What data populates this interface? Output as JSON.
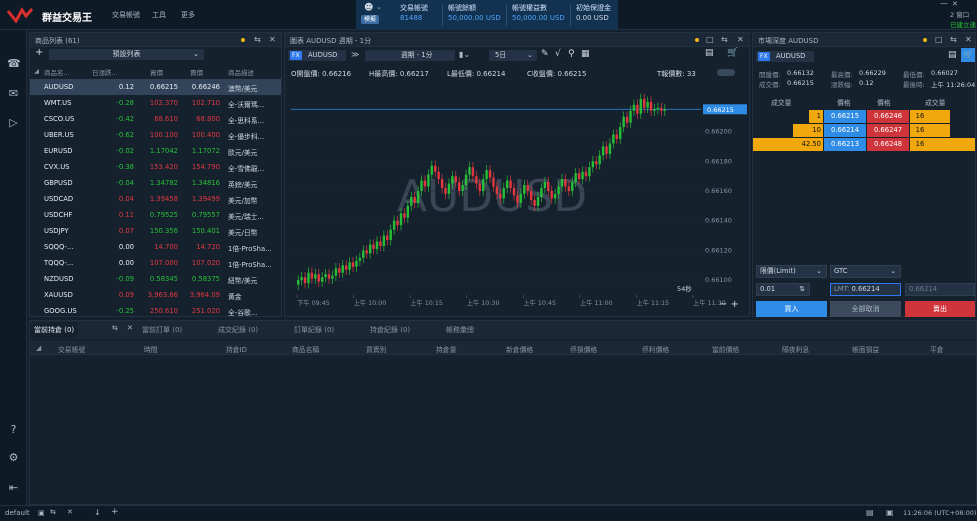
{
  "app": {
    "brand": "群益交易王",
    "menu": [
      "交易帳號",
      "工具",
      "更多"
    ]
  },
  "account": {
    "trade_label": "交易帳號",
    "trade_value": "81488",
    "badge": "模擬",
    "fields": [
      {
        "label": "帳號餘額",
        "value": "50,000.00 USD"
      },
      {
        "label": "帳號權益數",
        "value": "50,000.00 USD"
      },
      {
        "label": "初始保證金",
        "value": "0.00 USD"
      }
    ]
  },
  "window": {
    "zoom_label": "2 窗口",
    "status": "已建立連"
  },
  "product_list": {
    "title": "商品列表 (61)",
    "preset": "預設列表",
    "headers": [
      "商品名...",
      "日漲跌...",
      "買價",
      "賣價",
      "商品描述"
    ],
    "rows": [
      {
        "symbol": "AUDUSD",
        "change": "0.12",
        "bid": "0.66215",
        "ask": "0.66246",
        "desc": "澳幣/美元",
        "dir": "fl",
        "bdir": "fl",
        "selected": true
      },
      {
        "symbol": "WMT.US",
        "change": "-0.28",
        "bid": "102.370",
        "ask": "102.710",
        "desc": "全-沃爾瑪...",
        "dir": "up",
        "bdir": "dn"
      },
      {
        "symbol": "CSCO.US",
        "change": "-0.42",
        "bid": "68.610",
        "ask": "68.800",
        "desc": "全-思科系...",
        "dir": "up",
        "bdir": "dn"
      },
      {
        "symbol": "UBER.US",
        "change": "-0.62",
        "bid": "100.100",
        "ask": "100.400",
        "desc": "全-優步科...",
        "dir": "up",
        "bdir": "dn"
      },
      {
        "symbol": "EURUSD",
        "change": "-0.02",
        "bid": "1.17042",
        "ask": "1.17072",
        "desc": "歐元/美元",
        "dir": "up",
        "bdir": "up"
      },
      {
        "symbol": "CVX.US",
        "change": "-0.38",
        "bid": "153.420",
        "ask": "154.790",
        "desc": "全-雪佛龍...",
        "dir": "up",
        "bdir": "dn"
      },
      {
        "symbol": "GBPUSD",
        "change": "-0.04",
        "bid": "1.34782",
        "ask": "1.34816",
        "desc": "英鎊/美元",
        "dir": "up",
        "bdir": "up"
      },
      {
        "symbol": "USDCAD",
        "change": "0.04",
        "bid": "1.39458",
        "ask": "1.39499",
        "desc": "美元/加幣",
        "dir": "dn",
        "bdir": "dn"
      },
      {
        "symbol": "USDCHF",
        "change": "0.11",
        "bid": "0.79525",
        "ask": "0.79557",
        "desc": "美元/瑞士...",
        "dir": "dn",
        "bdir": "up"
      },
      {
        "symbol": "USDJPY",
        "change": "0.07",
        "bid": "150.356",
        "ask": "150.401",
        "desc": "美元/日幣",
        "dir": "dn",
        "bdir": "up"
      },
      {
        "symbol": "SQQQ-...",
        "change": "0.00",
        "bid": "14.700",
        "ask": "14.720",
        "desc": "1倍-ProSha...",
        "dir": "fl",
        "bdir": "dn"
      },
      {
        "symbol": "TQQQ-...",
        "change": "0.00",
        "bid": "107.000",
        "ask": "107.020",
        "desc": "1倍-ProSha...",
        "dir": "fl",
        "bdir": "dn"
      },
      {
        "symbol": "NZDUSD",
        "change": "-0.09",
        "bid": "0.58345",
        "ask": "0.58375",
        "desc": "紐幣/美元",
        "dir": "up",
        "bdir": "up"
      },
      {
        "symbol": "XAUUSD",
        "change": "0.09",
        "bid": "3,963.66",
        "ask": "3,964.09",
        "desc": "黃金",
        "dir": "dn",
        "bdir": "dn"
      },
      {
        "symbol": "GOOG.US",
        "change": "-0.25",
        "bid": "250.610",
        "ask": "251.020",
        "desc": "全-谷歌...",
        "dir": "up",
        "bdir": "dn"
      }
    ]
  },
  "chart": {
    "title": "圖表 AUDUSD 週期 - 1分",
    "symbol": "AUDUSD",
    "symbol_tag": "FX",
    "period": "週期 - 1分",
    "range": "5日",
    "watermark": "AUDUSD",
    "ohlc": {
      "open": "O開盤價: 0.66216",
      "high": "H最高價: 0.66217",
      "low": "L最低價: 0.66214",
      "close": "C收盤價: 0.66215",
      "ticks": "T報價數: 33"
    },
    "countdown": "54秒",
    "current_price": "0.66215"
  },
  "chart_data": {
    "type": "candlestick",
    "y_ticks": [
      "0.66200",
      "0.66180",
      "0.66160",
      "0.66140",
      "0.66120",
      "0.66100"
    ],
    "x_ticks": [
      "下午 09:45",
      "上午 10:00",
      "上午 10:15",
      "上午 10:30",
      "上午 10:45",
      "上午 11:00",
      "上午 11:15",
      "上午 11:30"
    ],
    "ylim": [
      0.6609,
      0.6623
    ],
    "closes": [
      0.661,
      0.66102,
      0.66098,
      0.66105,
      0.66101,
      0.66104,
      0.66099,
      0.66102,
      0.66104,
      0.66101,
      0.66103,
      0.66108,
      0.66105,
      0.6611,
      0.66107,
      0.66112,
      0.66109,
      0.66113,
      0.66115,
      0.6612,
      0.66118,
      0.66124,
      0.66121,
      0.66126,
      0.66123,
      0.6613,
      0.66127,
      0.66134,
      0.6614,
      0.66137,
      0.66145,
      0.66142,
      0.6615,
      0.66156,
      0.66152,
      0.6616,
      0.66167,
      0.66163,
      0.66171,
      0.66177,
      0.66173,
      0.66168,
      0.66162,
      0.66158,
      0.66165,
      0.6617,
      0.66166,
      0.6616,
      0.66164,
      0.66171,
      0.66176,
      0.6617,
      0.66165,
      0.6616,
      0.66168,
      0.66174,
      0.66169,
      0.66163,
      0.66158,
      0.66155,
      0.66162,
      0.66167,
      0.66162,
      0.66157,
      0.66152,
      0.66158,
      0.66164,
      0.6616,
      0.66154,
      0.6615,
      0.66156,
      0.66162,
      0.66166,
      0.6616,
      0.66155,
      0.66158,
      0.66163,
      0.66168,
      0.66163,
      0.6616,
      0.66166,
      0.66172,
      0.66168,
      0.66173,
      0.6617,
      0.66176,
      0.6618,
      0.66178,
      0.66184,
      0.6619,
      0.66185,
      0.66192,
      0.66198,
      0.66195,
      0.66203,
      0.6621,
      0.66206,
      0.66214,
      0.66218,
      0.66212,
      0.66222,
      0.66216,
      0.6622,
      0.66214,
      0.66215,
      0.66216,
      0.66214,
      0.66215
    ]
  },
  "depth": {
    "title": "市場深度 AUDUSD",
    "symbol": "AUDUSD",
    "symbol_tag": "FX",
    "stats": [
      {
        "label": "開盤價:",
        "value": "0.66132"
      },
      {
        "label": "最高價:",
        "value": "0.66229"
      },
      {
        "label": "最低價:",
        "value": "0.66027"
      },
      {
        "label": "成交價:",
        "value": "0.66215"
      },
      {
        "label": "漲跌幅:",
        "value": "0.12"
      },
      {
        "label": "最後時:",
        "value": "上午 11:26:04"
      }
    ],
    "headers": [
      "成交量",
      "價格",
      "價格",
      "成交量"
    ],
    "rows": [
      {
        "lvol": "1",
        "bid": "0.66215",
        "ask": "0.66246",
        "rvol": "16"
      },
      {
        "lvol": "10",
        "bid": "0.66214",
        "ask": "0.66247",
        "rvol": "16"
      },
      {
        "lvol": "42.50",
        "bid": "0.66213",
        "ask": "0.66248",
        "rvol": "16"
      }
    ],
    "order_type": "限價(Limit)",
    "tif": "GTC",
    "qty": "0.01",
    "lmt_label": "LMT:",
    "lmt": "0.66214",
    "stop": "0.66214",
    "buy": "買入",
    "cancel_all": "全部取消",
    "sell": "賣出"
  },
  "bottom": {
    "tabs": [
      "當前持倉 (0)",
      "當前訂單 (0)",
      "成交紀錄 (0)",
      "訂單紀錄 (0)",
      "持倉紀錄 (0)",
      "帳務彙總"
    ],
    "headers": [
      "交易帳號",
      "時間",
      "持倉ID",
      "商品名稱",
      "買賣別",
      "持倉量",
      "新倉價格",
      "停損價格",
      "停利價格",
      "當前價格",
      "隔夜利息",
      "帳面損益",
      "平倉"
    ]
  },
  "status": {
    "workspace": "default",
    "clock": "11:26:06 (UTC+08:00)"
  }
}
